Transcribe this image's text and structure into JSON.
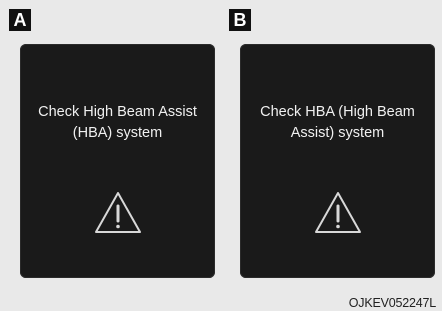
{
  "panels": [
    {
      "tag": "A",
      "message": "Check High Beam Assist\n(HBA) system",
      "icon": "warning-triangle-icon"
    },
    {
      "tag": "B",
      "message": "Check HBA (High Beam\nAssist) system",
      "icon": "warning-triangle-icon"
    }
  ],
  "reference_code": "OJKEV052247L",
  "colors": {
    "background": "#e9e9e9",
    "display": "#1a1a1a",
    "text": "#f0f0f0",
    "tag": "#111111"
  }
}
